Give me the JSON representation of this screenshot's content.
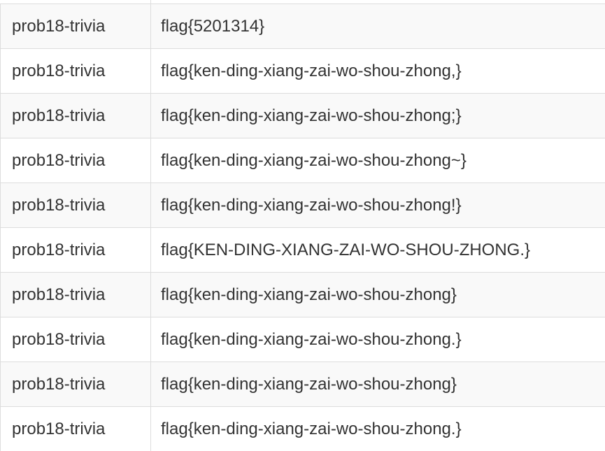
{
  "table": {
    "rows": [
      {
        "challenge": "prob18-trivia",
        "submission": "flag{5201314}"
      },
      {
        "challenge": "prob18-trivia",
        "submission": "flag{ken-ding-xiang-zai-wo-shou-zhong,}"
      },
      {
        "challenge": "prob18-trivia",
        "submission": "flag{ken-ding-xiang-zai-wo-shou-zhong;}"
      },
      {
        "challenge": "prob18-trivia",
        "submission": "flag{ken-ding-xiang-zai-wo-shou-zhong~}"
      },
      {
        "challenge": "prob18-trivia",
        "submission": "flag{ken-ding-xiang-zai-wo-shou-zhong!}"
      },
      {
        "challenge": "prob18-trivia",
        "submission": "flag{KEN-DING-XIANG-ZAI-WO-SHOU-ZHONG.}"
      },
      {
        "challenge": "prob18-trivia",
        "submission": "flag{ken-ding-xiang-zai-wo-shou-zhong}"
      },
      {
        "challenge": "prob18-trivia",
        "submission": "flag{ken-ding-xiang-zai-wo-shou-zhong.}"
      },
      {
        "challenge": "prob18-trivia",
        "submission": "flag{ken-ding-xiang-zai-wo-shou-zhong}"
      },
      {
        "challenge": "prob18-trivia",
        "submission": "flag{ken-ding-xiang-zai-wo-shou-zhong.}"
      }
    ]
  }
}
